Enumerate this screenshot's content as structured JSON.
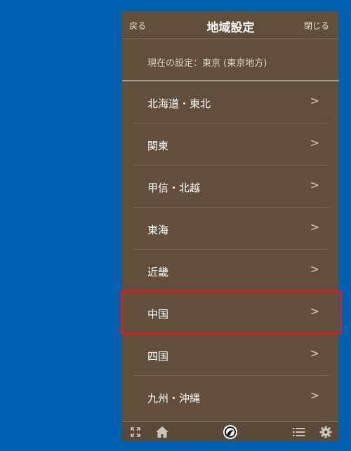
{
  "header": {
    "back_label": "戻る",
    "title": "地域設定",
    "close_label": "閉じる"
  },
  "current_setting": "現在の設定：東京 (東京地方)",
  "regions": [
    {
      "label": "北海道・東北"
    },
    {
      "label": "関東"
    },
    {
      "label": "甲信・北越"
    },
    {
      "label": "東海"
    },
    {
      "label": "近畿"
    },
    {
      "label": "中国"
    },
    {
      "label": "四国"
    },
    {
      "label": "九州・沖縄"
    }
  ],
  "chevron_glyph": ">",
  "highlighted_region": "中国",
  "colors": {
    "page_background": "#0061b1",
    "panel_background": "#614f3c",
    "highlight_border": "#d81e1e"
  },
  "footer": {
    "icons": [
      "expand-icon",
      "home-icon",
      "logo-icon",
      "list-icon",
      "gear-icon"
    ]
  }
}
